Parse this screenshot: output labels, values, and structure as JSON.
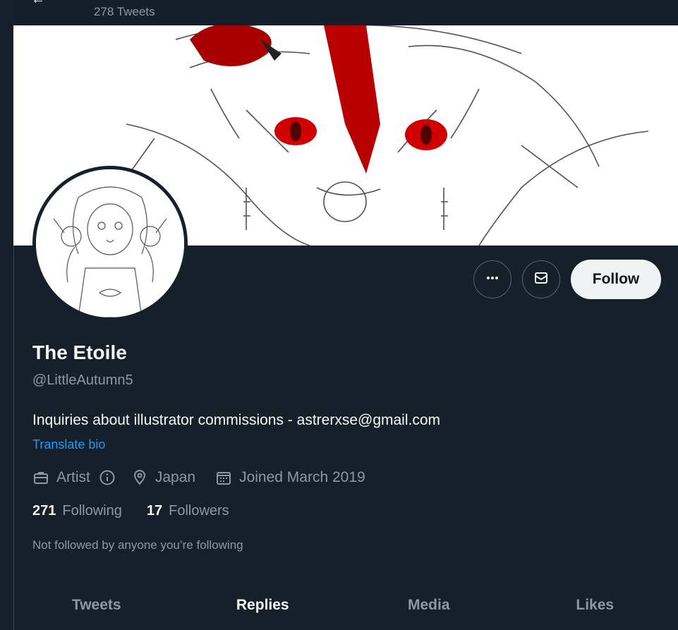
{
  "header": {
    "tweet_count": "278 Tweets"
  },
  "profile": {
    "display_name": "The Etoile",
    "handle": "@LittleAutumn5",
    "bio": "Inquiries about illustrator commissions - astrerxse@gmail.com",
    "translate_label": "Translate bio",
    "category": "Artist",
    "location": "Japan",
    "joined": "Joined March 2019",
    "following_count": "271",
    "following_label": "Following",
    "followers_count": "17",
    "followers_label": "Followers",
    "not_followed_text": "Not followed by anyone you’re following"
  },
  "actions": {
    "follow_label": "Follow",
    "more_icon": "more-icon",
    "message_icon": "envelope-icon"
  },
  "tabs": [
    {
      "label": "Tweets",
      "active": false
    },
    {
      "label": "Replies",
      "active": true
    },
    {
      "label": "Media",
      "active": false
    },
    {
      "label": "Likes",
      "active": false
    }
  ],
  "colors": {
    "background": "#15202b",
    "link": "#1d9bf0",
    "muted": "#8b98a5",
    "banner_accent": "#b30000"
  }
}
